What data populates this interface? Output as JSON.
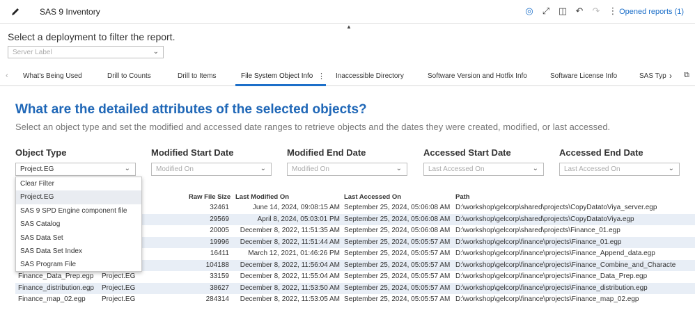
{
  "topbar": {
    "title": "SAS 9 Inventory",
    "opened_reports": "Opened reports (1)"
  },
  "deployment": {
    "prompt": "Select a deployment to filter the report.",
    "placeholder": "Server Label"
  },
  "tabs": [
    {
      "label": "What's Being Used"
    },
    {
      "label": "Drill to Counts"
    },
    {
      "label": "Drill to Items"
    },
    {
      "label": "File System Object Info"
    },
    {
      "label": "Inaccessible Directory"
    },
    {
      "label": "Software Version and Hotfix Info"
    },
    {
      "label": "Software License Info"
    },
    {
      "label": "SAS Typ"
    }
  ],
  "page": {
    "heading": "What are the detailed attributes of the selected objects?",
    "subheading": "Select an object type and set the modified and accessed date ranges to retrieve objects and the dates they were created, modified, or last accessed."
  },
  "filters": [
    {
      "label": "Object Type",
      "value": "Project.EG",
      "is_placeholder": false
    },
    {
      "label": "Modified Start Date",
      "value": "Modified On",
      "is_placeholder": true
    },
    {
      "label": "Modified End Date",
      "value": "Modified On",
      "is_placeholder": true
    },
    {
      "label": "Accessed Start Date",
      "value": "Last Accessed On",
      "is_placeholder": true
    },
    {
      "label": "Accessed End Date",
      "value": "Last Accessed On",
      "is_placeholder": true
    }
  ],
  "dropdown": {
    "options": [
      "Clear Filter",
      "Project.EG",
      "SAS 9 SPD Engine component file",
      "SAS Catalog",
      "SAS Data Set",
      "SAS Data Set Index",
      "SAS Program File"
    ],
    "selected": "Project.EG"
  },
  "table": {
    "headers": {
      "size": "Raw File Size",
      "modified": "Last Modified On",
      "accessed": "Last Accessed On",
      "path": "Path"
    },
    "rows": [
      {
        "name": "",
        "type": "",
        "size": "32461",
        "modified": "June 14, 2024, 09:08:15 AM",
        "accessed": "September 25, 2024, 05:06:08 AM",
        "path": "D:\\workshop\\gelcorp\\shared\\projects\\CopyDatatoViya_server.egp"
      },
      {
        "name": "",
        "type": "",
        "size": "29569",
        "modified": "April 8, 2024, 05:03:01 PM",
        "accessed": "September 25, 2024, 05:06:08 AM",
        "path": "D:\\workshop\\gelcorp\\shared\\projects\\CopyDatatoViya.egp"
      },
      {
        "name": "",
        "type": "",
        "size": "20005",
        "modified": "December 8, 2022, 11:51:35 AM",
        "accessed": "September 25, 2024, 05:06:08 AM",
        "path": "D:\\workshop\\gelcorp\\shared\\projects\\Finance_01.egp"
      },
      {
        "name": "",
        "type": "",
        "size": "19996",
        "modified": "December 8, 2022, 11:51:44 AM",
        "accessed": "September 25, 2024, 05:05:57 AM",
        "path": "D:\\workshop\\gelcorp\\finance\\projects\\Finance_01.egp"
      },
      {
        "name": "",
        "type": "",
        "size": "16411",
        "modified": "March 12, 2021, 01:46:26 PM",
        "accessed": "September 25, 2024, 05:05:57 AM",
        "path": "D:\\workshop\\gelcorp\\finance\\projects\\Finance_Append_data.egp"
      },
      {
        "name": "",
        "type": "",
        "size": "104188",
        "modified": "December 8, 2022, 11:56:04 AM",
        "accessed": "September 25, 2024, 05:05:57 AM",
        "path": "D:\\workshop\\gelcorp\\finance\\projects\\Finance_Combine_and_Characte"
      },
      {
        "name": "Finance_Data_Prep.egp",
        "type": "Project.EG",
        "size": "33159",
        "modified": "December 8, 2022, 11:55:04 AM",
        "accessed": "September 25, 2024, 05:05:57 AM",
        "path": "D:\\workshop\\gelcorp\\finance\\projects\\Finance_Data_Prep.egp"
      },
      {
        "name": "Finance_distribution.egp",
        "type": "Project.EG",
        "size": "38627",
        "modified": "December 8, 2022, 11:53:50 AM",
        "accessed": "September 25, 2024, 05:05:57 AM",
        "path": "D:\\workshop\\gelcorp\\finance\\projects\\Finance_distribution.egp"
      },
      {
        "name": "Finance_map_02.egp",
        "type": "Project.EG",
        "size": "284314",
        "modified": "December 8, 2022, 11:53:05 AM",
        "accessed": "September 25, 2024, 05:05:57 AM",
        "path": "D:\\workshop\\gelcorp\\finance\\projects\\Finance_map_02.egp"
      }
    ]
  }
}
